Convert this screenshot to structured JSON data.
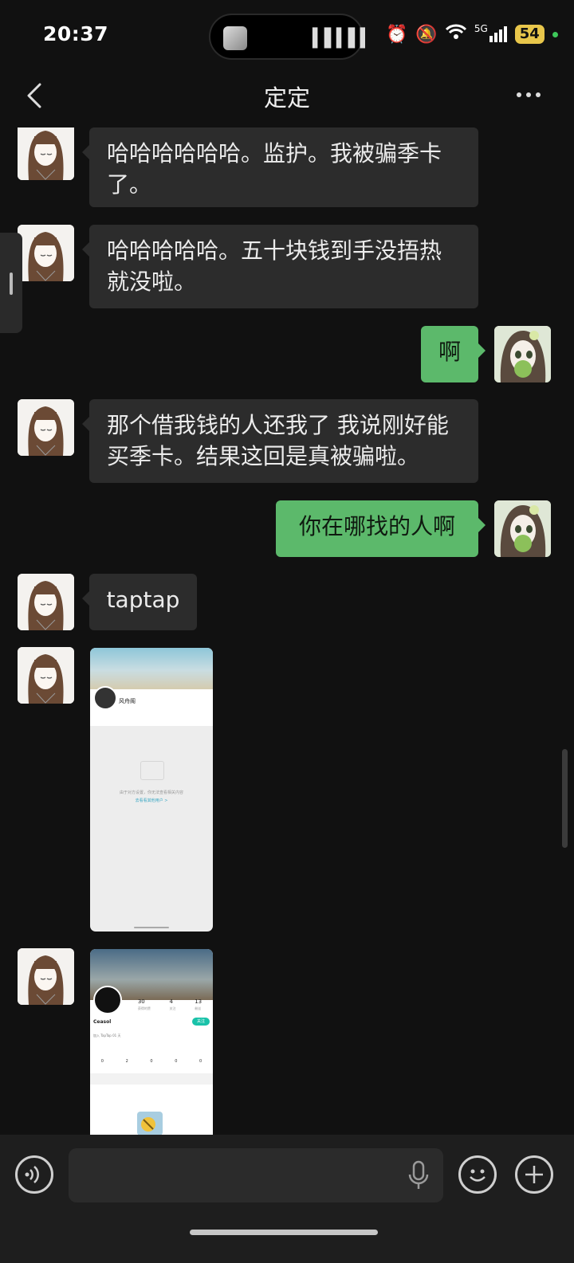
{
  "status_bar": {
    "time": "20:37",
    "network": "5G",
    "battery": "54"
  },
  "header": {
    "title": "定定"
  },
  "messages": [
    {
      "side": "in",
      "text": "哈哈哈哈哈哈。监护。我被骗季卡了。"
    },
    {
      "side": "in",
      "text": "哈哈哈哈哈。五十块钱到手没捂热就没啦。"
    },
    {
      "side": "out",
      "text": "啊"
    },
    {
      "side": "in",
      "text": "那个借我钱的人还我了 我说刚好能买季卡。结果这回是真被骗啦。"
    },
    {
      "side": "out",
      "text": "你在哪找的人啊"
    },
    {
      "side": "in",
      "text": "taptap"
    }
  ],
  "screenshots": [
    {
      "profile_name": "风舟阁",
      "empty_text": "由于对方设置，你无法查看相关内容",
      "empty_link": "去看看其他用户 >"
    },
    {
      "profile_name": "Ceasol",
      "stats": [
        {
          "value": "30",
          "label": "获得的赞"
        },
        {
          "value": "4",
          "label": "关注"
        },
        {
          "value": "13",
          "label": "粉丝"
        }
      ],
      "follow_label": "关注",
      "join_text": "加入 TapTap 01 天",
      "counts": [
        "0",
        "2",
        "0",
        "0",
        "0"
      ]
    }
  ],
  "colors": {
    "background": "#111111",
    "bubble_in": "#2c2c2c",
    "bubble_out": "#5cb96b"
  }
}
